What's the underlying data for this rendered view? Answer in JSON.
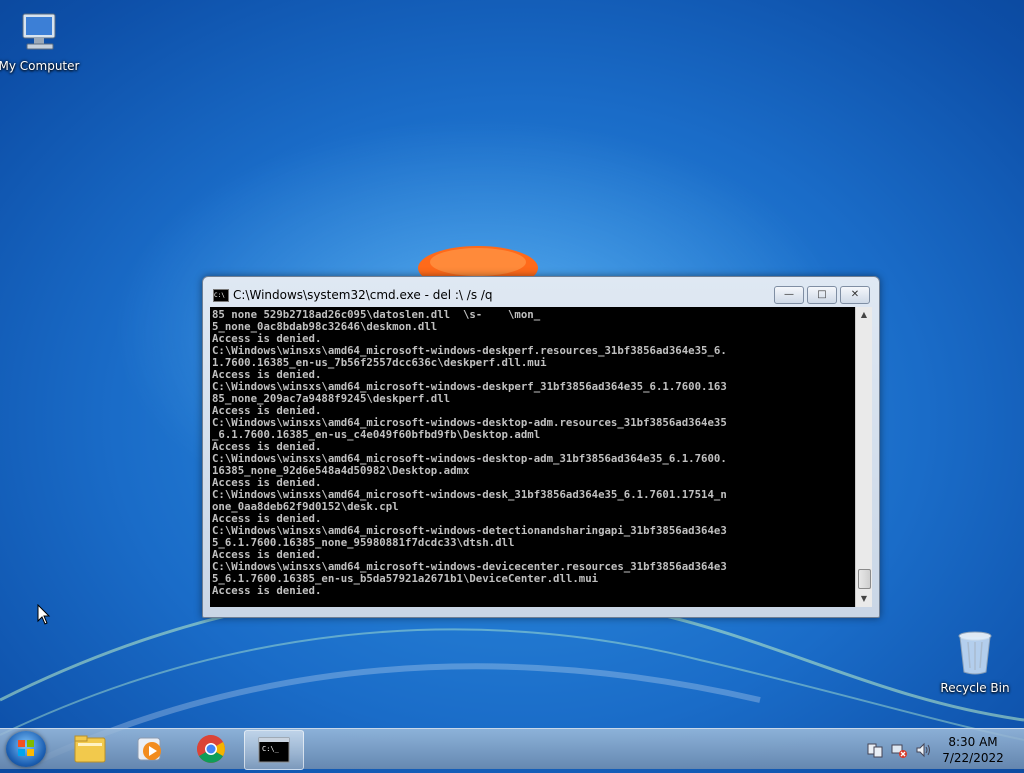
{
  "desktop": {
    "icons": [
      {
        "label": "My Computer"
      },
      {
        "label": "Recycle Bin"
      }
    ]
  },
  "window": {
    "title": "C:\\Windows\\system32\\cmd.exe - del  :\\ /s /q",
    "minimize_label": "—",
    "maximize_label": "□",
    "close_label": "✕",
    "console_lines": [
      "85 none 529b2718ad26c095\\datoslen.dll  \\s-    \\mon_",
      "5_none_0ac8bdab98c32646\\deskmon.dll",
      "Access is denied.",
      "C:\\Windows\\winsxs\\amd64_microsoft-windows-deskperf.resources_31bf3856ad364e35_6.",
      "1.7600.16385_en-us_7b56f2557dcc636c\\deskperf.dll.mui",
      "Access is denied.",
      "C:\\Windows\\winsxs\\amd64_microsoft-windows-deskperf_31bf3856ad364e35_6.1.7600.163",
      "85_none_209ac7a9488f9245\\deskperf.dll",
      "Access is denied.",
      "C:\\Windows\\winsxs\\amd64_microsoft-windows-desktop-adm.resources_31bf3856ad364e35",
      "_6.1.7600.16385_en-us_c4e049f60bfbd9fb\\Desktop.adml",
      "Access is denied.",
      "C:\\Windows\\winsxs\\amd64_microsoft-windows-desktop-adm_31bf3856ad364e35_6.1.7600.",
      "16385_none_92d6e548a4d50982\\Desktop.admx",
      "Access is denied.",
      "C:\\Windows\\winsxs\\amd64_microsoft-windows-desk_31bf3856ad364e35_6.1.7601.17514_n",
      "one_0aa8deb62f9d0152\\desk.cpl",
      "Access is denied.",
      "C:\\Windows\\winsxs\\amd64_microsoft-windows-detectionandsharingapi_31bf3856ad364e3",
      "5_6.1.7600.16385_none_95980881f7dcdc33\\dtsh.dll",
      "Access is denied.",
      "C:\\Windows\\winsxs\\amd64_microsoft-windows-devicecenter.resources_31bf3856ad364e3",
      "5_6.1.7600.16385_en-us_b5da57921a2671b1\\DeviceCenter.dll.mui",
      "Access is denied."
    ]
  },
  "taskbar": {
    "items": [
      "start-button",
      "explorer",
      "media-player",
      "chrome",
      "cmd"
    ],
    "clock_time": "8:30 AM",
    "clock_date": "7/22/2022"
  }
}
